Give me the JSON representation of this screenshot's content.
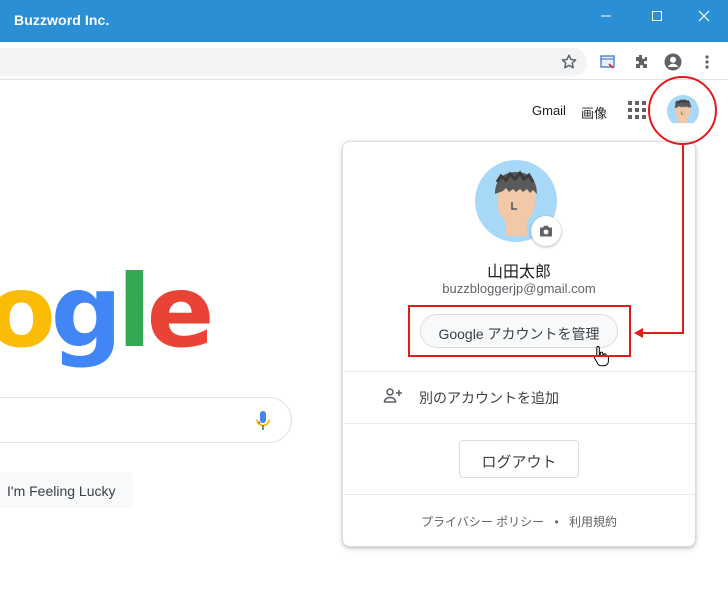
{
  "window": {
    "title": "Buzzword Inc."
  },
  "toolbar": {
    "icons": [
      "star-icon",
      "tab-search-icon",
      "extensions-icon",
      "profile-icon",
      "menu-icon"
    ]
  },
  "google": {
    "gmail": "Gmail",
    "images": "画像",
    "logo_letters": [
      "o",
      "g",
      "l",
      "e"
    ],
    "logo_colors": [
      "#fbbc05",
      "#4285f4",
      "#34a853",
      "#ea4335"
    ],
    "lucky": "I'm Feeling Lucky"
  },
  "account": {
    "name": "山田太郎",
    "email": "buzzbloggerjp@gmail.com",
    "manage": "Google アカウントを管理",
    "add_account": "別のアカウントを追加",
    "logout": "ログアウト",
    "privacy": "プライバシー ポリシー",
    "dot": "•",
    "terms": "利用規約"
  },
  "colors": {
    "titlebar": "#2b8fd6",
    "annotation": "#e21a1a"
  }
}
